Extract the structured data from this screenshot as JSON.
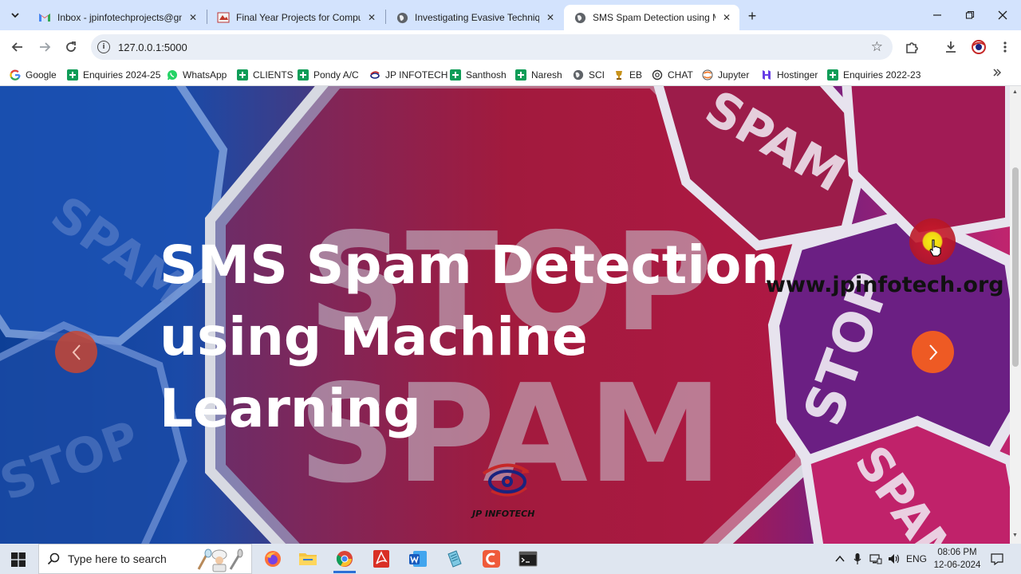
{
  "browser": {
    "tabs": [
      {
        "title": "Inbox - jpinfotechprojects@gm",
        "favicon": "gmail-icon",
        "active": false
      },
      {
        "title": "Final Year Projects for Compute",
        "favicon": "site-icon",
        "active": false
      },
      {
        "title": "Investigating Evasive Technique",
        "favicon": "globe-icon",
        "active": false
      },
      {
        "title": "SMS Spam Detection using Ma",
        "favicon": "globe-icon",
        "active": true
      }
    ],
    "address": "127.0.0.1:5000",
    "bookmarks": [
      {
        "label": "Google",
        "icon": "google-icon"
      },
      {
        "label": "Enquiries 2024-25",
        "icon": "sheets-icon"
      },
      {
        "label": "WhatsApp",
        "icon": "whatsapp-icon"
      },
      {
        "label": "CLIENTS",
        "icon": "sheets-icon"
      },
      {
        "label": "Pondy A/C",
        "icon": "sheets-icon"
      },
      {
        "label": "JP INFOTECH",
        "icon": "jp-logo-icon"
      },
      {
        "label": "Santhosh",
        "icon": "sheets-icon"
      },
      {
        "label": "Naresh",
        "icon": "sheets-icon"
      },
      {
        "label": "SCI",
        "icon": "globe-icon"
      },
      {
        "label": "EB",
        "icon": "trophy-icon"
      },
      {
        "label": "CHAT",
        "icon": "chatgpt-icon"
      },
      {
        "label": "Jupyter",
        "icon": "jupyter-icon"
      },
      {
        "label": "Hostinger",
        "icon": "hostinger-icon"
      },
      {
        "label": "Enquiries 2022-23",
        "icon": "sheets-icon"
      }
    ]
  },
  "hero": {
    "title_line1": "SMS Spam Detection",
    "title_line2": "using Machine",
    "title_line3": "Learning",
    "watermark": "www.jpinfotech.org",
    "logo_text": "JP INFOTECH",
    "background_words": [
      "STOP",
      "SPAM"
    ]
  },
  "taskbar": {
    "search_placeholder": "Type here to search",
    "language": "ENG",
    "time": "08:06 PM",
    "date": "12-06-2024"
  },
  "colors": {
    "tabstrip": "#d3e3fd",
    "next_button": "#ee5a24",
    "prev_button": "#c84632",
    "hero_blue": "#0d3f96",
    "hero_red": "#a6193a",
    "hero_purple": "#7a1f7c"
  }
}
